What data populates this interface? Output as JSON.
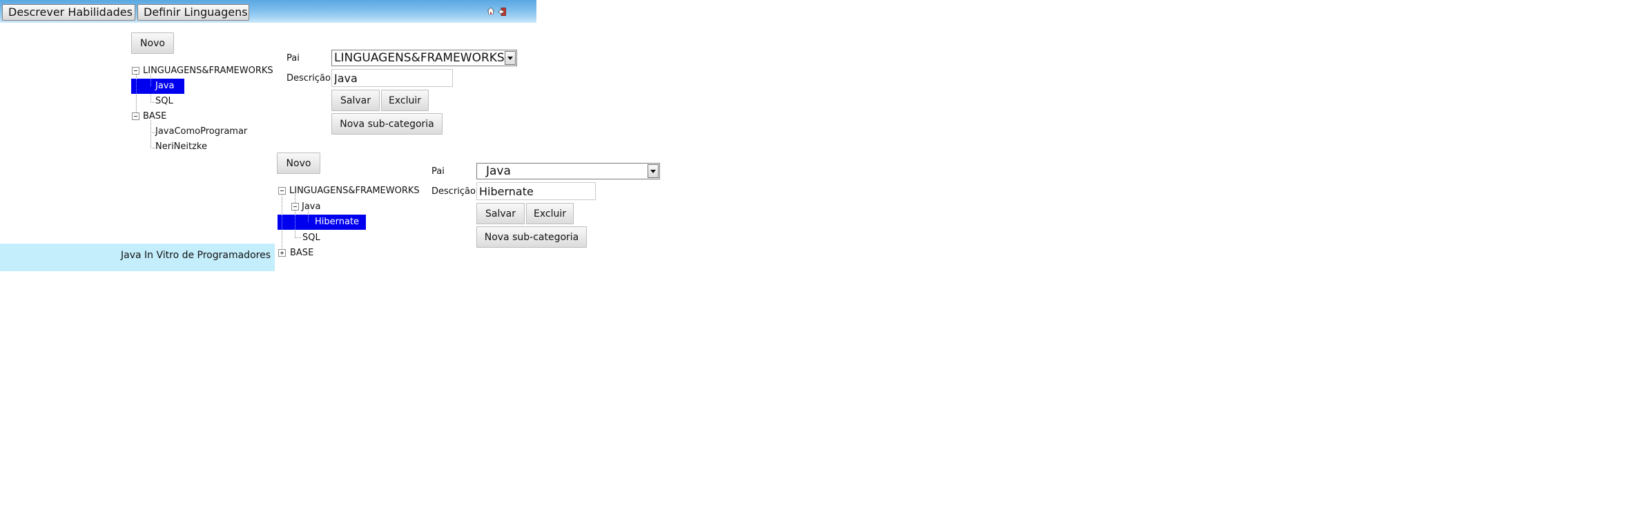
{
  "topbar": {
    "buttons": [
      "Descrever Habilidades",
      "Definir Linguagens"
    ],
    "icons": [
      "home-icon",
      "exit-icon"
    ]
  },
  "panel1": {
    "new_label": "Novo",
    "tree": {
      "root1": "LINGUAGENS&FRAMEWORKS",
      "root1_children": [
        "Java",
        "SQL"
      ],
      "root2": "BASE",
      "root2_children": [
        "JavaComoProgramar",
        "NeriNeitzke"
      ],
      "selected": "Java"
    },
    "form": {
      "pai_label": "Pai",
      "pai_value": "LINGUAGENS&FRAMEWORKS",
      "descricao_label": "Descrição",
      "descricao_value": "Java",
      "save_label": "Salvar",
      "delete_label": "Excluir",
      "new_sub_label": "Nova sub-categoria"
    }
  },
  "panel2": {
    "new_label": "Novo",
    "tree": {
      "root1": "LINGUAGENS&FRAMEWORKS",
      "java": "Java",
      "java_children": [
        "Hibernate"
      ],
      "sql": "SQL",
      "root2": "BASE",
      "selected": "Hibernate"
    },
    "form": {
      "pai_label": "Pai",
      "pai_value": "Java",
      "descricao_label": "Descrição",
      "descricao_value": "Hibernate",
      "save_label": "Salvar",
      "delete_label": "Excluir",
      "new_sub_label": "Nova sub-categoria"
    }
  },
  "footer": {
    "text": "Java In Vitro de Programadores"
  },
  "colors": {
    "selection": "#0000ee",
    "footer_bg": "#c4eefc",
    "topbar": "#7bbcec"
  }
}
